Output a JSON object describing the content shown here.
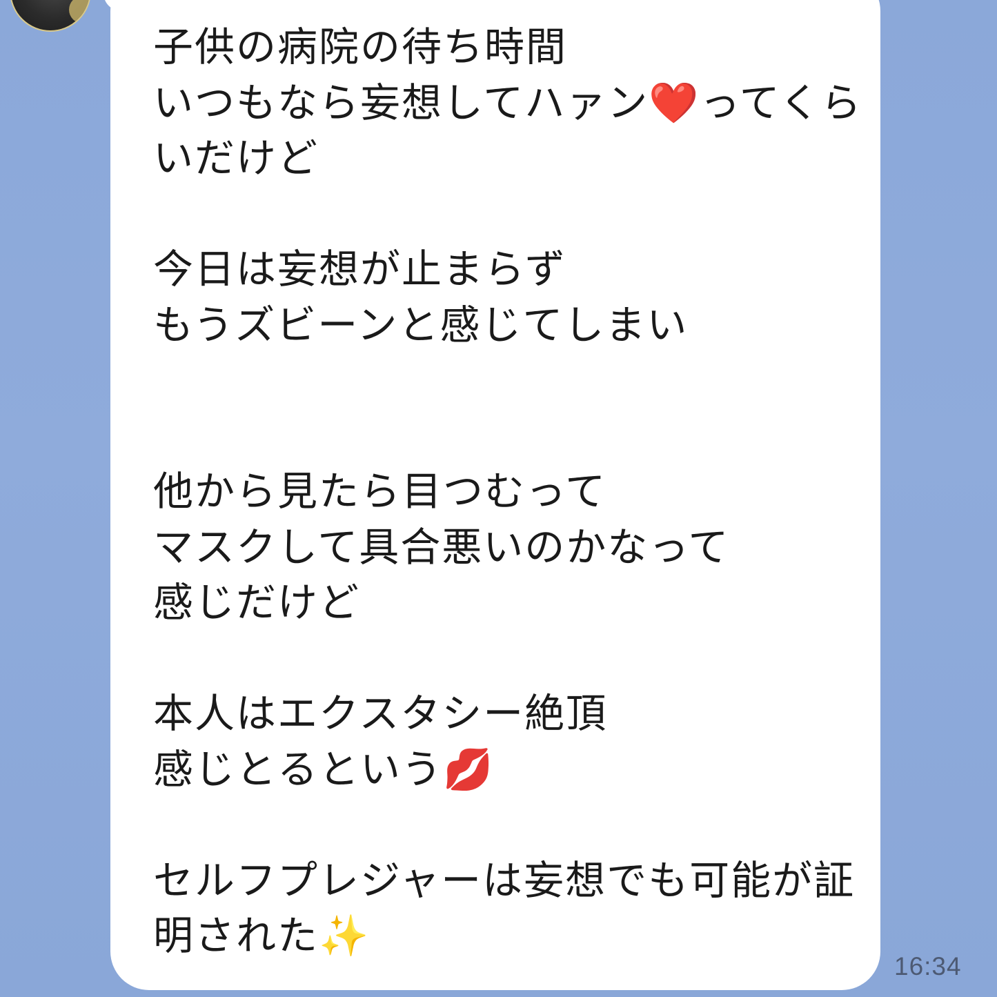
{
  "message": {
    "text": "子供の病院の待ち時間\nいつもなら妄想してハァン❤️ってくらいだけど\n\n今日は妄想が止まらず\nもうズビーンと感じてしまい\n\n\n他から見たら目つむって\nマスクして具合悪いのかなって\n感じだけど\n\n本人はエクスタシー絶頂\n感じとるという💋\n\nセルフプレジャーは妄想でも可能が証明された✨",
    "time": "16:34"
  },
  "avatar": {
    "icon": "user-avatar"
  },
  "colors": {
    "background": "#8eaad8",
    "bubble": "#ffffff",
    "text": "#1a1a1a",
    "timestamp": "#4d5a73"
  }
}
